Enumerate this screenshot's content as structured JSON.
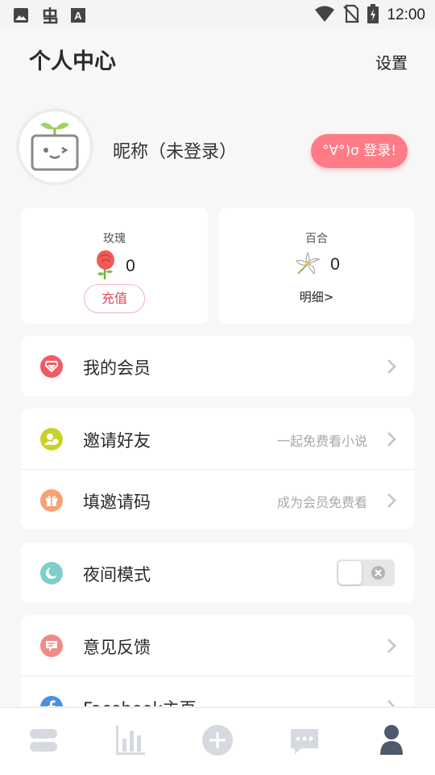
{
  "status_bar": {
    "time": "12:00",
    "icons": [
      "image-icon",
      "bug-icon",
      "font-icon",
      "wifi-icon",
      "no-sim-icon",
      "battery-charging-icon"
    ]
  },
  "header": {
    "title": "个人中心",
    "settings_label": "设置"
  },
  "profile": {
    "nickname": "昵称（未登录）",
    "login_label": "°∀°)σ 登录!"
  },
  "wallet": {
    "rose": {
      "label": "玫瑰",
      "value": "0",
      "button_label": "充值",
      "icon": "rose-icon"
    },
    "lily": {
      "label": "百合",
      "value": "0",
      "link_label": "明细>",
      "icon": "lily-icon"
    }
  },
  "menu": {
    "member": {
      "label": "我的会员",
      "icon": "diamond-icon",
      "color": "#f05b66"
    },
    "invite": {
      "label": "邀请好友",
      "hint": "一起免费看小说",
      "icon": "user-add-icon",
      "color": "#c9d12a"
    },
    "invite_code": {
      "label": "填邀请码",
      "hint": "成为会员免费看",
      "icon": "gift-icon",
      "color": "#f8a174"
    },
    "night_mode": {
      "label": "夜间模式",
      "icon": "moon-icon",
      "color": "#7ecfc9",
      "enabled": false
    },
    "feedback": {
      "label": "意见反馈",
      "icon": "message-icon",
      "color": "#f28a8a"
    },
    "facebook": {
      "label": "Facebook主页",
      "icon": "facebook-icon",
      "color": "#4a90e2"
    }
  },
  "tabbar": {
    "tabs": [
      {
        "name": "bookshelf",
        "icon": "bookshelf-icon"
      },
      {
        "name": "ranking",
        "icon": "bar-chart-icon"
      },
      {
        "name": "create",
        "icon": "plus-circle-icon"
      },
      {
        "name": "messages",
        "icon": "chat-icon"
      },
      {
        "name": "profile",
        "icon": "person-icon",
        "active": true
      }
    ],
    "active_color": "#4f5a6e",
    "inactive_color": "#d6d9df"
  }
}
